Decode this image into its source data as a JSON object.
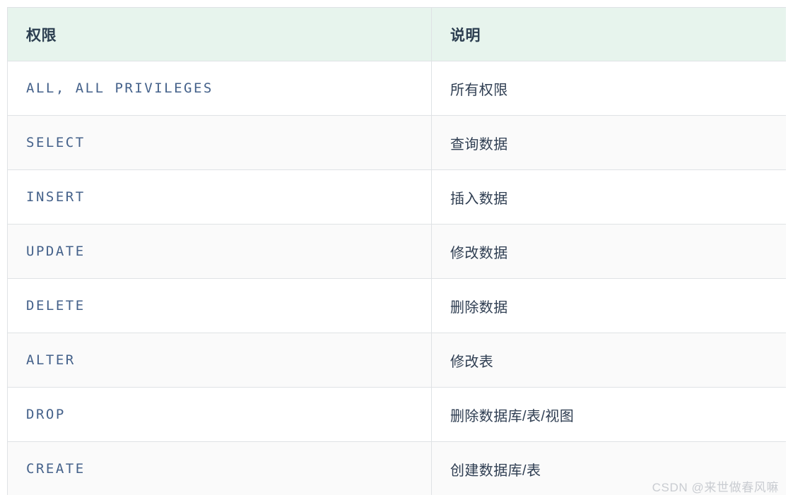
{
  "table": {
    "columns": [
      {
        "key": "privilege",
        "label": "权限"
      },
      {
        "key": "description",
        "label": "说明"
      }
    ],
    "rows": [
      {
        "privilege": "ALL, ALL PRIVILEGES",
        "description": "所有权限"
      },
      {
        "privilege": "SELECT",
        "description": "查询数据"
      },
      {
        "privilege": "INSERT",
        "description": "插入数据"
      },
      {
        "privilege": "UPDATE",
        "description": "修改数据"
      },
      {
        "privilege": "DELETE",
        "description": "删除数据"
      },
      {
        "privilege": "ALTER",
        "description": "修改表"
      },
      {
        "privilege": "DROP",
        "description": "删除数据库/表/视图"
      },
      {
        "privilege": "CREATE",
        "description": "创建数据库/表"
      }
    ]
  },
  "watermark": {
    "text": "CSDN @来世做春风嘛"
  },
  "colors": {
    "header_background": "#e7f4ed",
    "header_text": "#2c3e50",
    "border": "#dfe2e5",
    "row_odd_background": "#ffffff",
    "row_even_background": "#fafafa",
    "privilege_text": "#44618a",
    "description_text": "#2f3e52",
    "watermark_text": "#c9ccd1"
  }
}
